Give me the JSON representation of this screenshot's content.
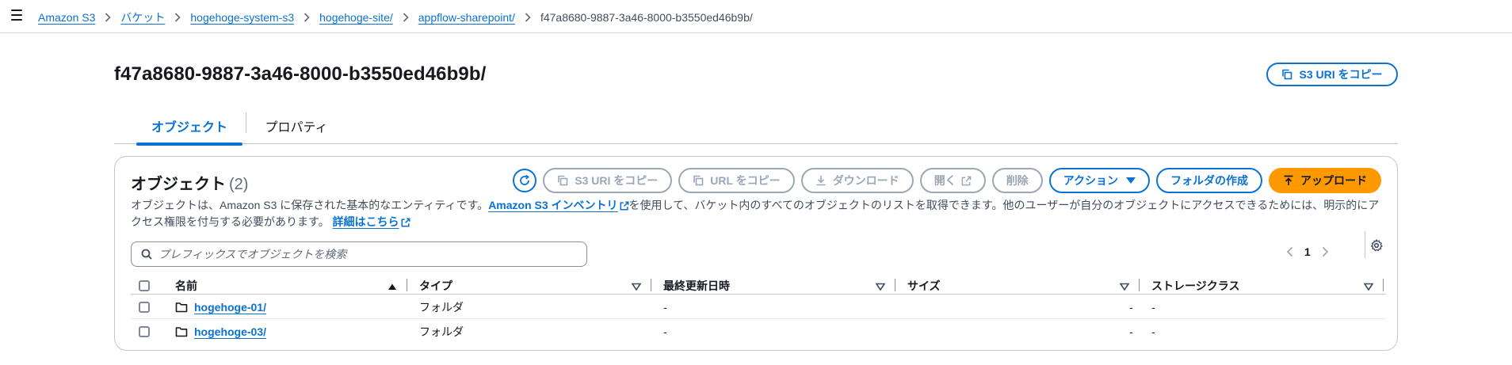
{
  "breadcrumb": {
    "items": [
      "Amazon S3",
      "バケット",
      "hogehoge-system-s3",
      "hogehoge-site/",
      "appflow-sharepoint/"
    ],
    "current": "f47a8680-9887-3a46-8000-b3550ed46b9b/"
  },
  "header": {
    "title": "f47a8680-9887-3a46-8000-b3550ed46b9b/",
    "copy_uri_label": "S3 URI をコピー"
  },
  "tabs": [
    {
      "label": "オブジェクト",
      "active": true
    },
    {
      "label": "プロパティ",
      "active": false
    }
  ],
  "objects": {
    "title": "オブジェクト",
    "count": "(2)",
    "toolbar": {
      "copy_s3_uri": "S3 URI をコピー",
      "copy_url": "URL をコピー",
      "download": "ダウンロード",
      "open": "開く",
      "delete": "削除",
      "actions": "アクション",
      "create_folder": "フォルダの作成",
      "upload": "アップロード"
    },
    "description": {
      "part1": "オブジェクトは、Amazon S3 に保存された基本的なエンティティです。",
      "inventory_link": "Amazon S3 インベントリ",
      "part2": "を使用して、バケット内のすべてのオブジェクトのリストを取得できます。他のユーザーが自分のオブジェクトにアクセスできるためには、明示的にアクセス権限を付与する必要があります。",
      "details_link": "詳細はこちら"
    },
    "search_placeholder": "プレフィックスでオブジェクトを検索",
    "page": "1",
    "columns": {
      "name": "名前",
      "type": "タイプ",
      "modified": "最終更新日時",
      "size": "サイズ",
      "storage": "ストレージクラス"
    },
    "rows": [
      {
        "name": "hogehoge-01/",
        "type": "フォルダ",
        "modified": "-",
        "size": "-",
        "storage": "-"
      },
      {
        "name": "hogehoge-03/",
        "type": "フォルダ",
        "modified": "-",
        "size": "-",
        "storage": "-"
      }
    ]
  },
  "colors": {
    "link": "#0972d3",
    "primary_button": "#ff9900",
    "disabled": "#9ba7b6"
  }
}
